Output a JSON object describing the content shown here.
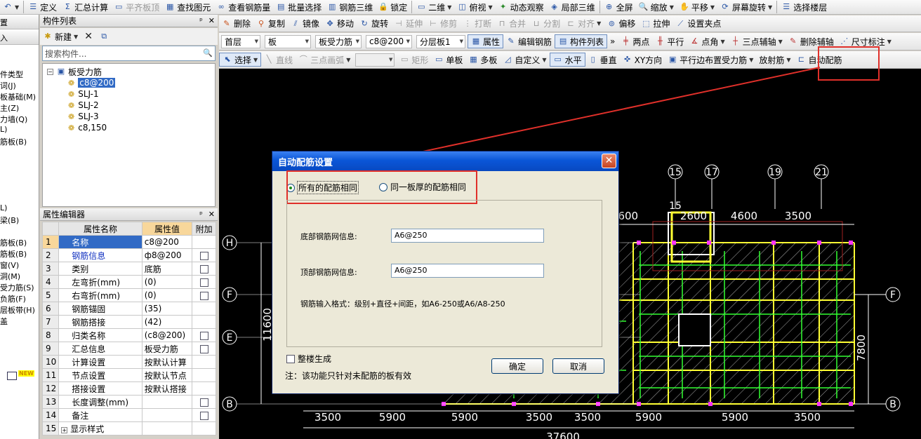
{
  "toolbar1": {
    "undo": "↶",
    "items": [
      "定义",
      "汇总计算",
      "平齐板顶",
      "查找图元",
      "查看钢筋量",
      "批量选择",
      "钢筋三维",
      "锁定",
      "二维",
      "俯视",
      "动态观察",
      "局部三维",
      "全屏",
      "缩放",
      "平移",
      "屏幕旋转",
      "选择楼层"
    ]
  },
  "toolbar2": {
    "items": [
      "删除",
      "复制",
      "镜像",
      "移动",
      "旋转",
      "延伸",
      "修剪",
      "打断",
      "合并",
      "分割",
      "对齐",
      "偏移",
      "拉伸",
      "设置夹点"
    ]
  },
  "toolbar3": {
    "floor": "首层",
    "category": "板",
    "type": "板受力筋",
    "rebar": "c8@200",
    "layer": "分层板1",
    "btn_props": "属性",
    "btn_edit_rebar": "编辑钢筋",
    "btn_comp_list": "构件列表",
    "items": [
      "两点",
      "平行",
      "点角",
      "三点辅轴",
      "删除辅轴",
      "尺寸标注"
    ]
  },
  "toolbar4": {
    "select": "选择",
    "items": [
      "直线",
      "三点画弧",
      "矩形",
      "单板",
      "多板",
      "自定义",
      "水平",
      "垂直",
      "XY方向",
      "平行边布置受力筋",
      "放射筋",
      "自动配筋"
    ]
  },
  "left_panel": {
    "items": [
      "置",
      "入",
      "件类型",
      "词(J)",
      "板基础(M)",
      "主(Z)",
      "力墙(Q)",
      "L)",
      "筋板(B)",
      "L)",
      "梁(B)",
      "筋板(B)",
      "筋板(B)",
      "窗(V)",
      "洞(M)",
      "受力筋(S)",
      "负筋(F)",
      "层板带(H)",
      "盖"
    ],
    "new_badge": "NEW"
  },
  "component_list": {
    "title": "构件列表",
    "new_btn": "新建",
    "search_placeholder": "搜索构件...",
    "root": "板受力筋",
    "children": [
      "c8@200",
      "SLJ-1",
      "SLJ-2",
      "SLJ-3",
      "c8,150"
    ]
  },
  "property_editor": {
    "title": "属性编辑器",
    "headers": [
      "属性名称",
      "属性值",
      "附加"
    ],
    "rows": [
      {
        "n": "1",
        "name": "名称",
        "val": "c8@200",
        "chk": false
      },
      {
        "n": "2",
        "name": "钢筋信息",
        "val": "ф8@200",
        "chk": true
      },
      {
        "n": "3",
        "name": "类别",
        "val": "底筋",
        "chk": true
      },
      {
        "n": "4",
        "name": "左弯折(mm)",
        "val": "(0)",
        "chk": true
      },
      {
        "n": "5",
        "name": "右弯折(mm)",
        "val": "(0)",
        "chk": true
      },
      {
        "n": "6",
        "name": "钢筋锚固",
        "val": "(35)",
        "chk": false
      },
      {
        "n": "7",
        "name": "钢筋搭接",
        "val": "(42)",
        "chk": false
      },
      {
        "n": "8",
        "name": "归类名称",
        "val": "(c8@200)",
        "chk": true
      },
      {
        "n": "9",
        "name": "汇总信息",
        "val": "板受力筋",
        "chk": true
      },
      {
        "n": "10",
        "name": "计算设置",
        "val": "按默认计算",
        "chk": false
      },
      {
        "n": "11",
        "name": "节点设置",
        "val": "按默认节点",
        "chk": false
      },
      {
        "n": "12",
        "name": "搭接设置",
        "val": "按默认搭接",
        "chk": false
      },
      {
        "n": "13",
        "name": "长度调整(mm)",
        "val": "",
        "chk": true
      },
      {
        "n": "14",
        "name": "备注",
        "val": "",
        "chk": true
      },
      {
        "n": "15",
        "name": "显示样式",
        "val": "",
        "chk": false
      }
    ]
  },
  "cad": {
    "top_axes": [
      "15",
      "17",
      "19",
      "21"
    ],
    "top_dims": [
      "4600",
      "2600",
      "4600",
      "3500"
    ],
    "inner_axis": "15",
    "left_axes": [
      "H",
      "F",
      "E",
      "B"
    ],
    "right_axes": [
      "F",
      "B"
    ],
    "left_dim": "11600",
    "right_dim": "7800",
    "bottom_dims": [
      "3500",
      "5900",
      "5900",
      "3500",
      "3500",
      "5900",
      "5900",
      "3500"
    ],
    "total_dim": "37600"
  },
  "dialog": {
    "title": "自动配筋设置",
    "close": "✕",
    "radio_all": "所有的配筋相同",
    "radio_thickness": "同一板厚的配筋相同",
    "bottom_label": "底部钢筋网信息:",
    "bottom_value": "A6@250",
    "top_label": "顶部钢筋网信息:",
    "top_value": "A6@250",
    "hint": "钢筋输入格式：级别+直径+间距，如A6-250或A6/A8-250",
    "whole_building": "整楼生成",
    "note": "注：该功能只针对未配筋的板有效",
    "ok": "确定",
    "cancel": "取消"
  }
}
